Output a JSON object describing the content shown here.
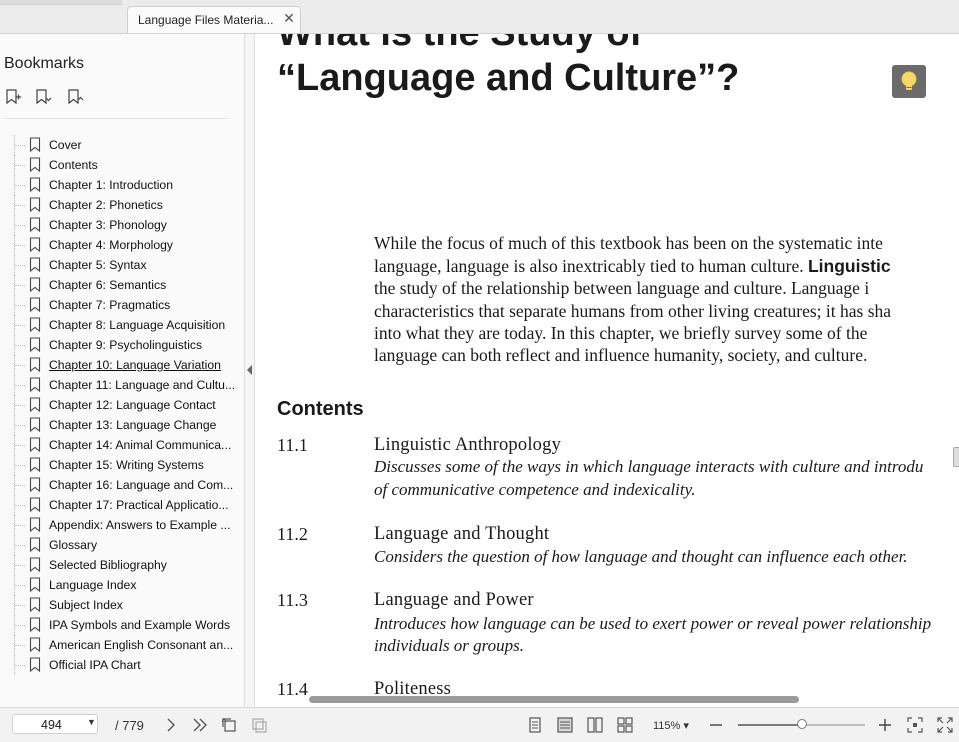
{
  "tab": {
    "title": "Language Files Materia...",
    "close_glyph": "✕"
  },
  "sidebar": {
    "title": "Bookmarks",
    "tools": [
      "add-bookmark-icon",
      "bookmark-expand-icon",
      "bookmark-collapse-icon"
    ],
    "items": [
      {
        "label": "Cover"
      },
      {
        "label": "Contents"
      },
      {
        "label": "Chapter 1: Introduction"
      },
      {
        "label": "Chapter 2: Phonetics"
      },
      {
        "label": "Chapter 3: Phonology"
      },
      {
        "label": "Chapter 4: Morphology"
      },
      {
        "label": "Chapter 5: Syntax"
      },
      {
        "label": "Chapter 6: Semantics"
      },
      {
        "label": "Chapter 7: Pragmatics"
      },
      {
        "label": "Chapter 8: Language Acquisition"
      },
      {
        "label": "Chapter 9: Psycholinguistics"
      },
      {
        "label": "Chapter 10: Language Variation",
        "active": true
      },
      {
        "label": "Chapter 11: Language and Cultu..."
      },
      {
        "label": "Chapter 12: Language Contact"
      },
      {
        "label": "Chapter 13: Language Change"
      },
      {
        "label": "Chapter 14: Animal Communica..."
      },
      {
        "label": "Chapter 15: Writing Systems"
      },
      {
        "label": "Chapter 16: Language and Com..."
      },
      {
        "label": "Chapter 17: Practical Applicatio..."
      },
      {
        "label": "Appendix: Answers to Example ..."
      },
      {
        "label": "Glossary"
      },
      {
        "label": "Selected Bibliography"
      },
      {
        "label": "Language Index"
      },
      {
        "label": "Subject Index"
      },
      {
        "label": "IPA Symbols and Example Words"
      },
      {
        "label": "American English Consonant an..."
      },
      {
        "label": "Official IPA Chart"
      }
    ]
  },
  "document": {
    "heading_line1": "What is the Study of",
    "heading_line2": "“Language and Culture”?",
    "intro": {
      "l1": "While the focus of much of this textbook has been on the systematic inte",
      "l2a": "language, language is also inextricably tied to human culture. ",
      "l2b": "Linguistic",
      "l3": "the study of the relationship between language and culture. Language i",
      "l4": "characteristics that separate humans from other living creatures; it has sha",
      "l5": "into what they are today. In this chapter, we briefly survey some of the",
      "l6": "language can both reflect and influence humanity, society, and culture."
    },
    "contents_heading": "Contents",
    "sections": [
      {
        "num": "11.1",
        "title": "Linguistic Anthropology",
        "desc": [
          "Discusses some of the ways in which language interacts with culture and introdu",
          "of communicative competence and indexicality."
        ]
      },
      {
        "num": "11.2",
        "title": "Language and Thought",
        "desc": [
          "Considers the question of how language and thought can influence each other."
        ]
      },
      {
        "num": "11.3",
        "title": "Language and Power",
        "desc": [
          "Introduces how language can be used to exert power or reveal power relationship",
          "individuals or groups."
        ]
      },
      {
        "num": "11.4",
        "title": "Politeness",
        "desc": []
      }
    ]
  },
  "statusbar": {
    "page_current": "494",
    "page_total": "/ 779",
    "zoom": "115%",
    "zoom_fraction": 0.5
  }
}
